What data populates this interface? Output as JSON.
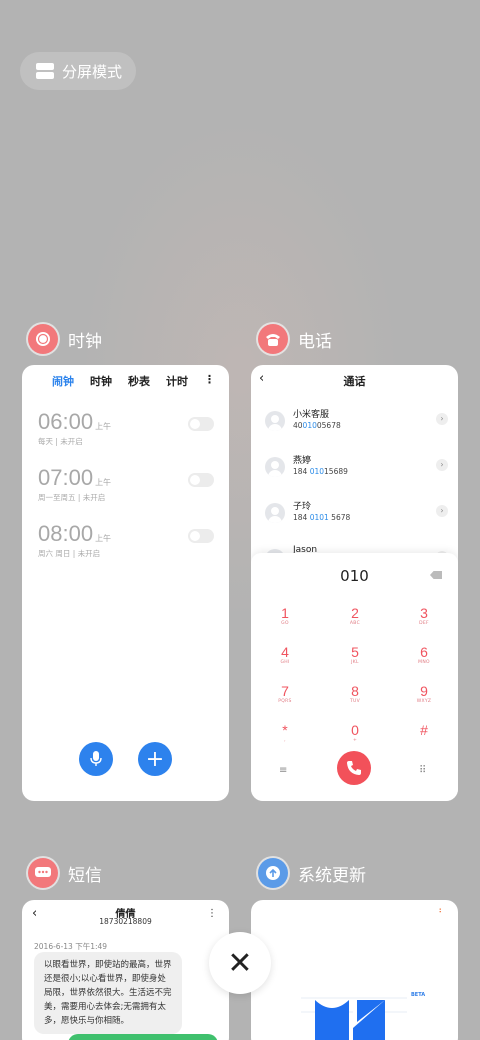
{
  "split_screen": {
    "label": "分屏模式"
  },
  "apps": {
    "clock": {
      "name": "时钟",
      "tabs": [
        "闹钟",
        "时钟",
        "秒表",
        "计时"
      ],
      "more": "⋮",
      "alarms": [
        {
          "time": "06:00",
          "ampm": "上午",
          "repeat": "每天 | 未开启"
        },
        {
          "time": "07:00",
          "ampm": "上午",
          "repeat": "周一至周五 | 未开启"
        },
        {
          "time": "08:00",
          "ampm": "上午",
          "repeat": "周六 周日 | 未开启"
        }
      ],
      "add": "+"
    },
    "phone": {
      "name": "电话",
      "title": "通话",
      "back": "‹",
      "contacts": [
        {
          "name": "小米客服",
          "pre": "40",
          "hl": "010",
          "post": "05678"
        },
        {
          "name": "燕婷",
          "pre": "184 ",
          "hl": "010",
          "post": "15689"
        },
        {
          "name": "子玲",
          "pre": "184 ",
          "hl": "0101",
          "post": " 5678"
        },
        {
          "name": "Jason",
          "pre": "",
          "hl": "",
          "post": ""
        }
      ],
      "dialed": "010",
      "keys": [
        {
          "d": "1",
          "l": "GO"
        },
        {
          "d": "2",
          "l": "ABC"
        },
        {
          "d": "3",
          "l": "DEF"
        },
        {
          "d": "4",
          "l": "GHI"
        },
        {
          "d": "5",
          "l": "JKL"
        },
        {
          "d": "6",
          "l": "MNO"
        },
        {
          "d": "7",
          "l": "PQRS"
        },
        {
          "d": "8",
          "l": "TUV"
        },
        {
          "d": "9",
          "l": "WXYZ"
        },
        {
          "d": "*",
          "l": ","
        },
        {
          "d": "0",
          "l": "+"
        },
        {
          "d": "#",
          "l": ""
        }
      ],
      "menu_icon": "≡",
      "keypad_icon": "⠿"
    },
    "sms": {
      "name": "短信",
      "contact": "倩倩",
      "number": "18730218809",
      "timestamp": "2016-6-13 下午1:49",
      "message": "以眼看世界，即使站的最高，世界还是很小;以心看世界，即使身处局限，世界依然很大。生活远不完美，需要用心去体会;无需拥有太多，愿快乐与你相随。",
      "back": "‹",
      "more": "⋮"
    },
    "update": {
      "name": "系统更新",
      "badge": "BETA"
    }
  },
  "close": "✕"
}
